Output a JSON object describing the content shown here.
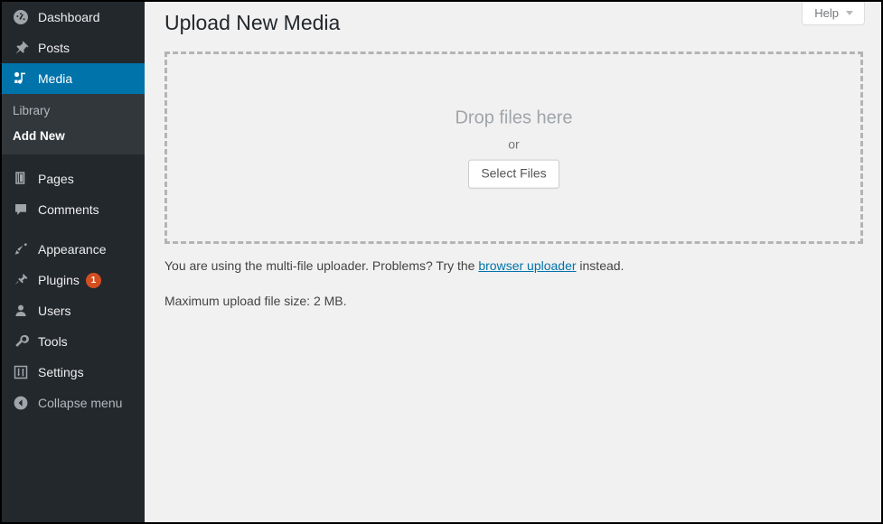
{
  "sidebar": {
    "items": [
      {
        "label": "Dashboard",
        "icon": "dashboard-icon",
        "name": "dashboard",
        "current": false
      },
      {
        "label": "Posts",
        "icon": "pin-icon",
        "name": "posts",
        "current": false
      },
      {
        "label": "Media",
        "icon": "media-icon",
        "name": "media",
        "current": true
      },
      {
        "label": "Pages",
        "icon": "pages-icon",
        "name": "pages",
        "current": false
      },
      {
        "label": "Comments",
        "icon": "comments-icon",
        "name": "comments",
        "current": false
      },
      {
        "label": "Appearance",
        "icon": "paintbrush-icon",
        "name": "appearance",
        "current": false
      },
      {
        "label": "Plugins",
        "icon": "plug-icon",
        "name": "plugins",
        "current": false,
        "badge": "1"
      },
      {
        "label": "Users",
        "icon": "user-icon",
        "name": "users",
        "current": false
      },
      {
        "label": "Tools",
        "icon": "wrench-icon",
        "name": "tools",
        "current": false
      },
      {
        "label": "Settings",
        "icon": "sliders-icon",
        "name": "settings",
        "current": false
      }
    ],
    "media_submenu": [
      {
        "label": "Library",
        "current": false
      },
      {
        "label": "Add New",
        "current": true
      }
    ],
    "collapse": {
      "label": "Collapse menu",
      "icon": "arrow-left-circle-icon"
    },
    "colors": {
      "background": "#23282d",
      "submenu_background": "#32373c",
      "active": "#0073aa",
      "text": "#eeeeee",
      "muted_text": "#b4b9be",
      "badge": "#d54e21"
    }
  },
  "screen_meta": {
    "help_label": "Help",
    "help_icon": "chevron-down-icon"
  },
  "main": {
    "page_title": "Upload New Media",
    "dropzone": {
      "title": "Drop files here",
      "or": "or",
      "select_button": "Select Files"
    },
    "notice": {
      "before_link": "You are using the multi-file uploader. Problems? Try the ",
      "link_text": "browser uploader",
      "after_link": " instead."
    },
    "max_upload": "Maximum upload file size: 2 MB."
  },
  "colors": {
    "content_background": "#f1f1f1",
    "dropzone_border": "#b4b4b4",
    "link": "#0073aa",
    "title_text": "#23282d"
  }
}
